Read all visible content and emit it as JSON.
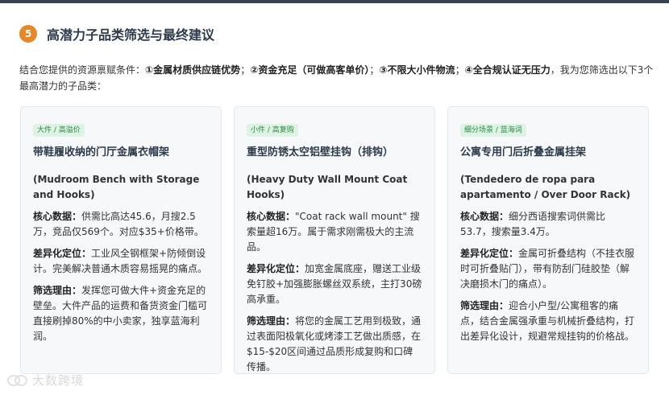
{
  "section": {
    "number": "5",
    "title": "高潜力子品类筛选与最终建议"
  },
  "intro": {
    "lead": "结合您提供的资源禀赋条件：",
    "cond1": "①金属材质供应链优势",
    "sep1": "；",
    "cond2": "②资金充足（可做高客单价）",
    "sep2": "；",
    "cond3": "③不限大小件物流",
    "sep3": "；",
    "cond4": "④全合规认证无压力",
    "tail": "，我为您筛选出以下3个最高潜力的子品类："
  },
  "cards": [
    {
      "tag": "大件 / 高溢价",
      "title": "带鞋履收纳的门厅金属衣帽架",
      "subtitle": "(Mudroom Bench with Storage and Hooks)",
      "data_label": "核心数据：",
      "data_text": "供需比高达45.6，月搜2.5万，竞品仅569个。对应$35+价格带。",
      "diff_label": "差异化定位：",
      "diff_text": "工业风全钢框架+防倾倒设计。完美解决普通木质容易摇晃的痛点。",
      "reason_label": "筛选理由：",
      "reason_text": "发挥您可做大件+资金充足的壁垒。大件产品的运费和备货资金门槛可直接刷掉80%的中小卖家，独享蓝海利润。"
    },
    {
      "tag": "小件 / 高复购",
      "title": "重型防锈太空铝壁挂钩（排钩）",
      "subtitle": "(Heavy Duty Wall Mount Coat Hooks)",
      "data_label": "核心数据：",
      "data_text": "\"Coat rack wall mount\" 搜索量超16万。属于需求刚需极大的主流品。",
      "diff_label": "差异化定位：",
      "diff_text": "加宽金属底座，赠送工业级免钉胶+加强膨胀螺丝双系统，主打30磅高承重。",
      "reason_label": "筛选理由：",
      "reason_text": "将您的金属工艺用到极致，通过表面阳极氧化或烤漆工艺做出质感，在$15-$20区间通过品质形成复购和口碑传播。"
    },
    {
      "tag": "细分场景 / 蓝海词",
      "title": "公寓专用门后折叠金属挂架",
      "subtitle": "(Tendedero de ropa para apartamento / Over Door Rack)",
      "data_label": "核心数据：",
      "data_text": "细分西语搜索词供需比53.7，搜索量3.4万。",
      "diff_label": "差异化定位：",
      "diff_text": "金属可折叠结构（不挂衣服时可折叠贴门），带有防刮门硅胶垫（解决磨损木门的痛点）。",
      "reason_label": "筛选理由：",
      "reason_text": "迎合小户型/公寓租客的痛点，结合金属强承重与机械折叠结构，打出差异化设计，规避常规挂钩的价格战。"
    }
  ],
  "watermark": {
    "text": "大数跨境"
  },
  "colors": {
    "badge": "#e8872a",
    "tag_bg": "#dff3e4",
    "tag_text": "#2a8a45",
    "card_bg": "#f7f8fa",
    "title": "#2d3a4a"
  }
}
